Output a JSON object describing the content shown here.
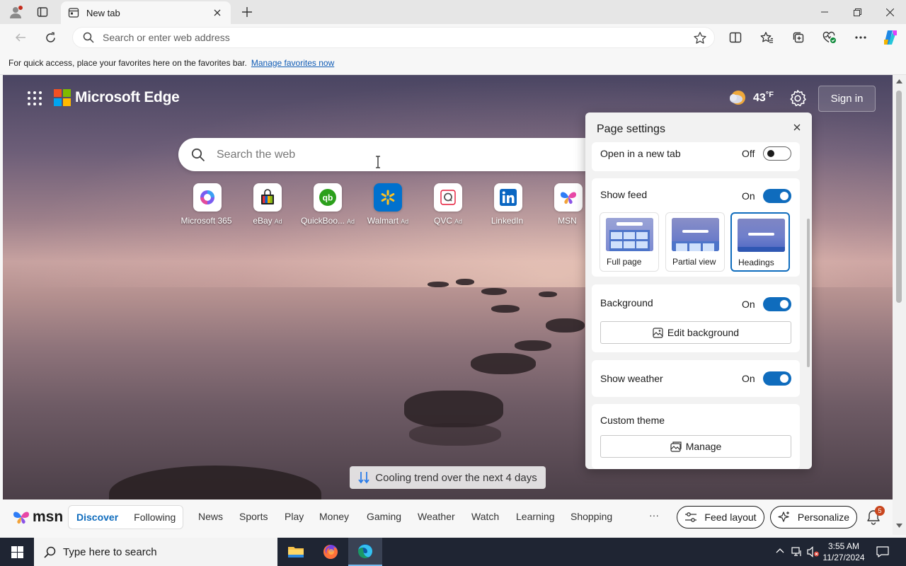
{
  "window": {
    "tab_title": "New tab",
    "minimize": "Minimize",
    "restore": "Restore",
    "close": "Close"
  },
  "toolbar": {
    "address_placeholder": "Search or enter web address"
  },
  "favbar": {
    "message": "For quick access, place your favorites here on the favorites bar.",
    "link": "Manage favorites now"
  },
  "ntp": {
    "brand": "Microsoft Edge",
    "weather_temp": "43",
    "weather_unit": "°F",
    "sign_in": "Sign in",
    "search_placeholder": "Search the web",
    "quicklinks": [
      {
        "label": "Microsoft 365",
        "ad": ""
      },
      {
        "label": "eBay",
        "ad": "Ad"
      },
      {
        "label": "QuickBoo...",
        "ad": "Ad"
      },
      {
        "label": "Walmart",
        "ad": "Ad"
      },
      {
        "label": "QVC",
        "ad": "Ad"
      },
      {
        "label": "LinkedIn",
        "ad": ""
      },
      {
        "label": "MSN",
        "ad": ""
      }
    ],
    "trend": "Cooling trend over the next 4 days"
  },
  "page_settings": {
    "title": "Page settings",
    "open_new_tab": {
      "label": "Open in a new tab",
      "state": "Off"
    },
    "show_feed": {
      "label": "Show feed",
      "state": "On"
    },
    "layouts": [
      "Full page",
      "Partial view",
      "Headings"
    ],
    "selected_layout": "Headings",
    "background": {
      "label": "Background",
      "state": "On",
      "button": "Edit background"
    },
    "show_weather": {
      "label": "Show weather",
      "state": "On"
    },
    "custom_theme": {
      "label": "Custom theme",
      "button": "Manage"
    }
  },
  "msn": {
    "logo": "msn",
    "discover": "Discover",
    "following": "Following",
    "nav": [
      "News",
      "Sports",
      "Play",
      "Money",
      "Gaming",
      "Weather",
      "Watch",
      "Learning",
      "Shopping"
    ],
    "more": "···",
    "feed_layout": "Feed layout",
    "personalize": "Personalize",
    "notification_count": "5"
  },
  "taskbar": {
    "search_placeholder": "Type here to search",
    "time": "3:55 AM",
    "date": "11/27/2024"
  },
  "colors": {
    "accent": "#0f6cbd",
    "link": "#0f5bb5",
    "taskbar": "#1f2533"
  }
}
